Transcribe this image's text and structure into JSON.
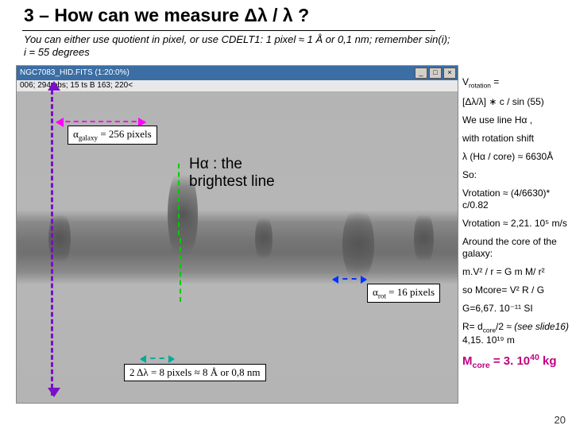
{
  "title": "3 – How can we measure Δλ / λ ?",
  "subtitle": "You can either use quotient in pixel, or use CDELT1: 1 pixel ≈ 1 Å or 0,1 nm; remember sin(i); i = 55 degrees",
  "window": {
    "title": "NGC7083_HID.FITS (1:20:0%)",
    "status": "006; 294 obs; 15 ts B 163; 220<",
    "btn_min": "_",
    "btn_max": "□",
    "btn_close": "×"
  },
  "labels": {
    "alpha_galaxy": "αgalaxy = 256 pixels",
    "halpha_line1": "Hα : the",
    "halpha_line2": "brightest line",
    "alpha_rot": "αrot = 16 pixels",
    "delta_lambda": "2 Δλ = 8 pixels ≈ 8 Å or 0,8 nm"
  },
  "right": {
    "l1a": "V",
    "l1b": " =",
    "l2": "[Δλ/λ] ∗ c / sin (55)",
    "l3": "We use line  Hα ,",
    "l4": "with rotation shift",
    "l5": "λ (Hα / core) ≈ 6630Å",
    "l6": "So:",
    "l7": "Vrotation ≈ (4/6630)* c/0.82",
    "l8": "Vrotation ≈ 2,21. 10⁵ m/s",
    "l9": "Around the core of the galaxy:",
    "l10": "m.V² / r = G m M/ r²",
    "l11": "so Mcore= V² R / G",
    "l12": "G=6,67. 10⁻¹¹ SI",
    "l13_a": "R= d",
    "l13_b": "/2 ≈ ",
    "l13_c": "(see slide16)",
    "l13_d": " 4,15. 10¹⁹ m",
    "mcore_a": "M",
    "mcore_b": " = 3. 10",
    "mcore_c": " kg",
    "rot_sub": "rotation",
    "core_sub": "core",
    "exp40": "40"
  },
  "slidenum": "20"
}
